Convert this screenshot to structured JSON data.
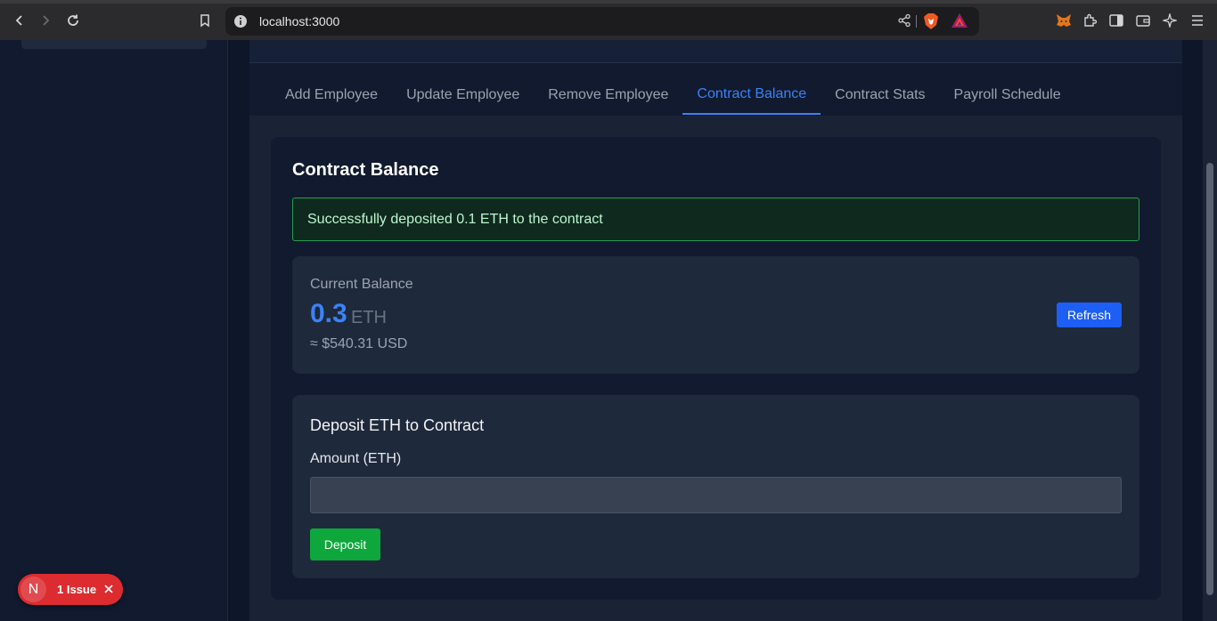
{
  "browser": {
    "url": "localhost:3000"
  },
  "tabs": [
    {
      "label": "Add Employee"
    },
    {
      "label": "Update Employee"
    },
    {
      "label": "Remove Employee"
    },
    {
      "label": "Contract Balance",
      "active": true
    },
    {
      "label": "Contract Stats"
    },
    {
      "label": "Payroll Schedule"
    }
  ],
  "card": {
    "title": "Contract Balance",
    "alert": "Successfully deposited 0.1 ETH to the contract",
    "balance": {
      "label": "Current Balance",
      "value": "0.3",
      "unit": "ETH",
      "usd": "≈ $540.31 USD",
      "refresh_label": "Refresh"
    },
    "deposit": {
      "title": "Deposit ETH to Contract",
      "amount_label": "Amount (ETH)",
      "amount_value": "",
      "button_label": "Deposit"
    }
  },
  "issues": {
    "avatar": "N",
    "label": "1 Issue"
  },
  "colors": {
    "accent": "#3b82f6",
    "success": "#22a052",
    "danger": "#dc2c30"
  }
}
